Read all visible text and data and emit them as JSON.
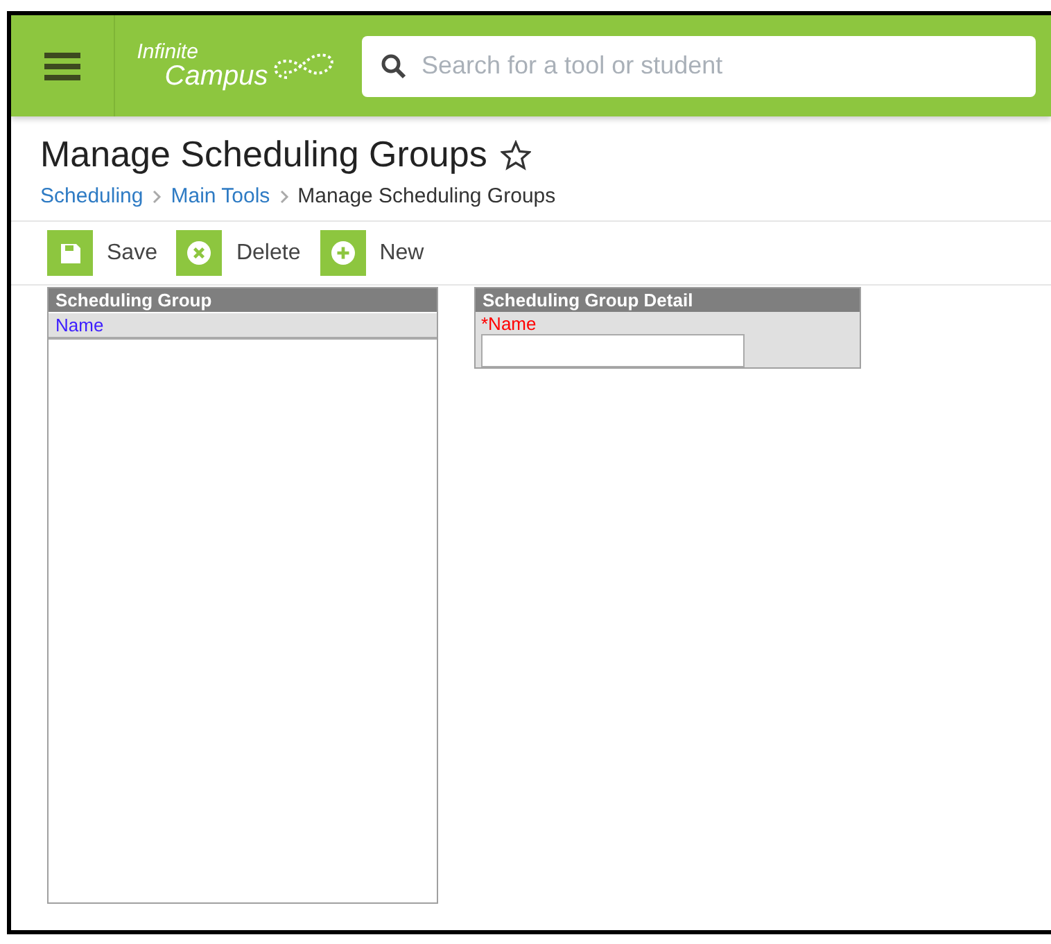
{
  "header": {
    "logo": {
      "line_1": "Infinite",
      "line_2": "Campus"
    },
    "search": {
      "placeholder": "Search for a tool or student"
    }
  },
  "page": {
    "title": "Manage Scheduling Groups",
    "favorite": false
  },
  "breadcrumb": [
    {
      "label": "Scheduling",
      "kind": "link"
    },
    {
      "label": "Main Tools",
      "kind": "link"
    },
    {
      "label": "Manage Scheduling Groups",
      "kind": "current"
    }
  ],
  "toolbar": [
    {
      "label": "Save",
      "kind": "save"
    },
    {
      "label": "Delete",
      "kind": "delete"
    },
    {
      "label": "New",
      "kind": "new"
    }
  ],
  "list_panel": {
    "title": "Scheduling Group",
    "column": "Name"
  },
  "detail_panel": {
    "title": "Scheduling Group Detail",
    "field": {
      "label": "*Name"
    }
  }
}
